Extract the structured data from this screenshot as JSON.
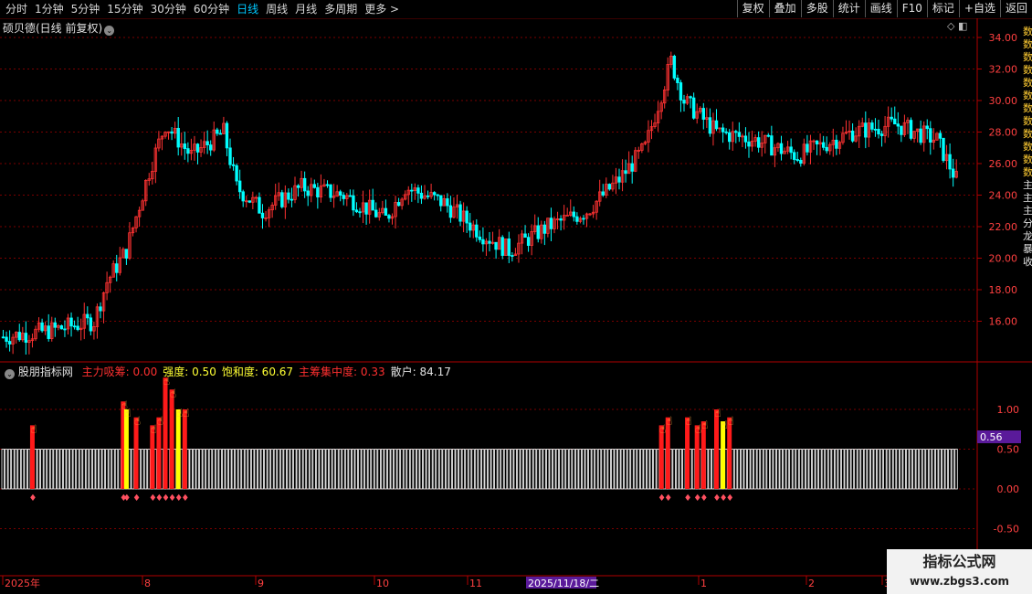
{
  "toolbar": {
    "tabs": [
      "分时",
      "1分钟",
      "5分钟",
      "15分钟",
      "30分钟",
      "60分钟",
      "日线",
      "周线",
      "月线",
      "多周期",
      "更多 >"
    ],
    "active_tab": "日线",
    "right_buttons": [
      "复权",
      "叠加",
      "多股",
      "统计",
      "画线",
      "F10",
      "标记",
      "+自选",
      "返回"
    ]
  },
  "main_panel": {
    "title": "硕贝德(日线 前复权)",
    "price_axis": [
      "34.00",
      "32.00",
      "30.00",
      "28.00",
      "26.00",
      "24.00",
      "22.00",
      "20.00",
      "18.00",
      "16.00"
    ],
    "icons": [
      "diamond-icon",
      "layout-icon"
    ]
  },
  "indicator_panel": {
    "name": "股朋指标网",
    "values": [
      {
        "label": "主力吸筹: 0.00",
        "color": "#ff3030"
      },
      {
        "label": "强度: 0.50",
        "color": "#ffff33"
      },
      {
        "label": "饱和度: 60.67",
        "color": "#ffff33"
      },
      {
        "label": "主筹集中度: 0.33",
        "color": "#ff3030"
      },
      {
        "label": "散户: 84.17",
        "color": "#e0e0e0"
      }
    ],
    "axis": [
      "1.00",
      "0.50",
      "0.00",
      "-0.50"
    ],
    "current_value": "0.56"
  },
  "time_axis": {
    "labels": [
      "2025年",
      "8",
      "9",
      "10",
      "11",
      "1",
      "2",
      "3"
    ],
    "cursor_label": "2025/11/18/二"
  },
  "right_edge_text": [
    "数",
    "数",
    "数",
    "数",
    "数",
    "数",
    "数",
    "数",
    "数",
    "数",
    "数",
    "数",
    "主",
    "主",
    "主",
    "分",
    "龙",
    "暴",
    "收"
  ],
  "watermark": {
    "line1": "指标公式网",
    "line2": "www.zbgs3.com"
  },
  "colors": {
    "up": "#ff3232",
    "down": "#00ffff",
    "grid": "#7a0000",
    "yellow": "#ffff00",
    "cursor_bg": "#5a1a9a"
  },
  "chart_data": {
    "type": "candlestick",
    "title": "硕贝德(日线 前复权)",
    "ylim": [
      14.0,
      35.0
    ],
    "close_samples": [
      {
        "x": "2025-07",
        "close": 15.0
      },
      {
        "x": "2025-08 early",
        "close": 16.5
      },
      {
        "x": "2025-08 mid",
        "close": 27.5
      },
      {
        "x": "2025-08 late",
        "close": 28.5
      },
      {
        "x": "2025-09",
        "close": 23.0
      },
      {
        "x": "2025-10",
        "close": 25.0
      },
      {
        "x": "2025-11",
        "close": 21.0
      },
      {
        "x": "2025-12",
        "close": 25.0
      },
      {
        "x": "2026-01",
        "close": 33.0
      },
      {
        "x": "2026-02",
        "close": 27.0
      },
      {
        "x": "2026-03",
        "close": 24.5
      }
    ]
  }
}
